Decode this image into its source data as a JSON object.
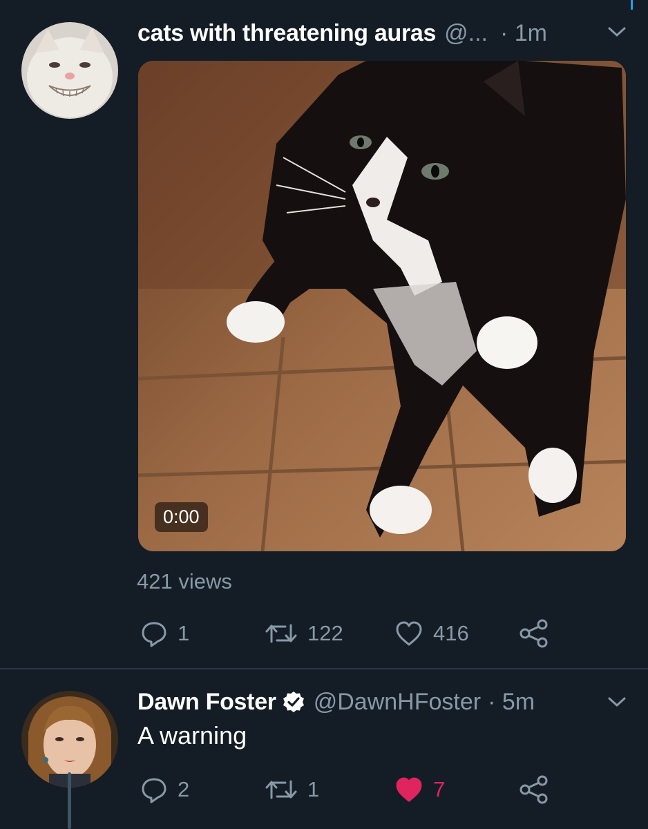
{
  "tweets": [
    {
      "author_name": "cats with threatening auras",
      "handle": "@...",
      "time": "· 1m",
      "video_time": "0:00",
      "views": "421 views",
      "actions": {
        "reply_count": "1",
        "retweet_count": "122",
        "like_count": "416"
      }
    },
    {
      "author_name": "Dawn Foster",
      "verified": true,
      "handle": "@DawnHFoster",
      "time": "· 5m",
      "text": "A warning",
      "actions": {
        "reply_count": "2",
        "retweet_count": "1",
        "like_count": "7",
        "liked": true
      }
    }
  ],
  "icons": {
    "caret": "chevron-down-icon",
    "reply": "reply-icon",
    "retweet": "retweet-icon",
    "like": "heart-icon",
    "share": "share-icon",
    "verified": "verified-badge-icon"
  },
  "colors": {
    "background": "#141d26",
    "secondary_text": "#8899a6",
    "like_active": "#e0245e",
    "accent": "#1da1f2"
  }
}
